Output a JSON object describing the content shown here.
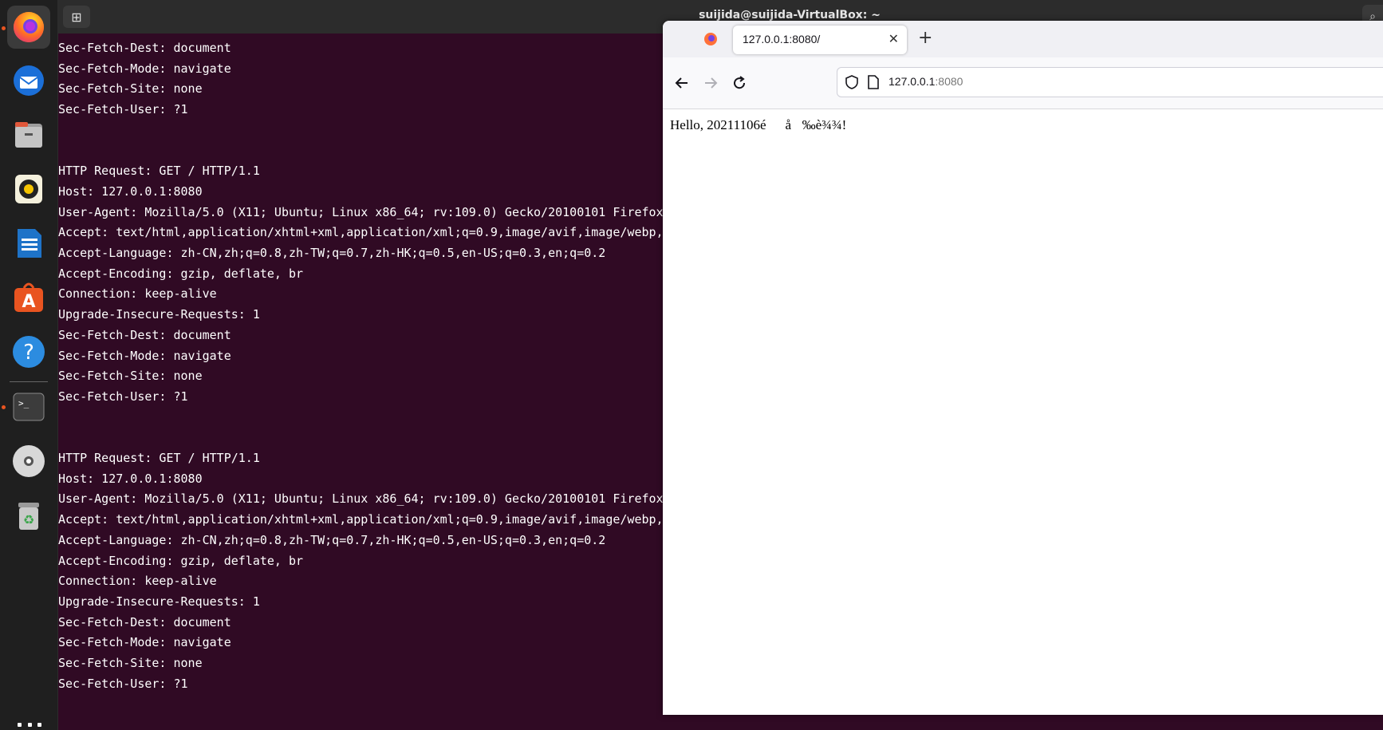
{
  "terminal": {
    "title": "suijida@suijida-VirtualBox: ~",
    "lines": [
      "Sec-Fetch-Dest: document",
      "Sec-Fetch-Mode: navigate",
      "Sec-Fetch-Site: none",
      "Sec-Fetch-User: ?1",
      "",
      "",
      "HTTP Request: GET / HTTP/1.1",
      "Host: 127.0.0.1:8080",
      "User-Agent: Mozilla/5.0 (X11; Ubuntu; Linux x86_64; rv:109.0) Gecko/20100101 Firefox/",
      "Accept: text/html,application/xhtml+xml,application/xml;q=0.9,image/avif,image/webp,",
      "Accept-Language: zh-CN,zh;q=0.8,zh-TW;q=0.7,zh-HK;q=0.5,en-US;q=0.3,en;q=0.2",
      "Accept-Encoding: gzip, deflate, br",
      "Connection: keep-alive",
      "Upgrade-Insecure-Requests: 1",
      "Sec-Fetch-Dest: document",
      "Sec-Fetch-Mode: navigate",
      "Sec-Fetch-Site: none",
      "Sec-Fetch-User: ?1",
      "",
      "",
      "HTTP Request: GET / HTTP/1.1",
      "Host: 127.0.0.1:8080",
      "User-Agent: Mozilla/5.0 (X11; Ubuntu; Linux x86_64; rv:109.0) Gecko/20100101 Firefox/",
      "Accept: text/html,application/xhtml+xml,application/xml;q=0.9,image/avif,image/webp,",
      "Accept-Language: zh-CN,zh;q=0.8,zh-TW;q=0.7,zh-HK;q=0.5,en-US;q=0.3,en;q=0.2",
      "Accept-Encoding: gzip, deflate, br",
      "Connection: keep-alive",
      "Upgrade-Insecure-Requests: 1",
      "Sec-Fetch-Dest: document",
      "Sec-Fetch-Mode: navigate",
      "Sec-Fetch-Site: none",
      "Sec-Fetch-User: ?1"
    ]
  },
  "browser": {
    "tab_title": "127.0.0.1:8080/",
    "url_host": "127.0.0.1",
    "url_port": ":8080",
    "page_text": "Hello, 20211106éå‰è¾¾!"
  },
  "dock": {
    "items": [
      "firefox-icon",
      "thunderbird-icon",
      "files-icon",
      "rhythmbox-icon",
      "writer-icon",
      "app-center-icon",
      "help-icon",
      "terminal-icon",
      "dvd-icon",
      "trash-icon"
    ],
    "running_dot_color": "#e95420"
  },
  "colors": {
    "terminal_bg": "#300a24",
    "terminal_fg": "#ffffff"
  }
}
